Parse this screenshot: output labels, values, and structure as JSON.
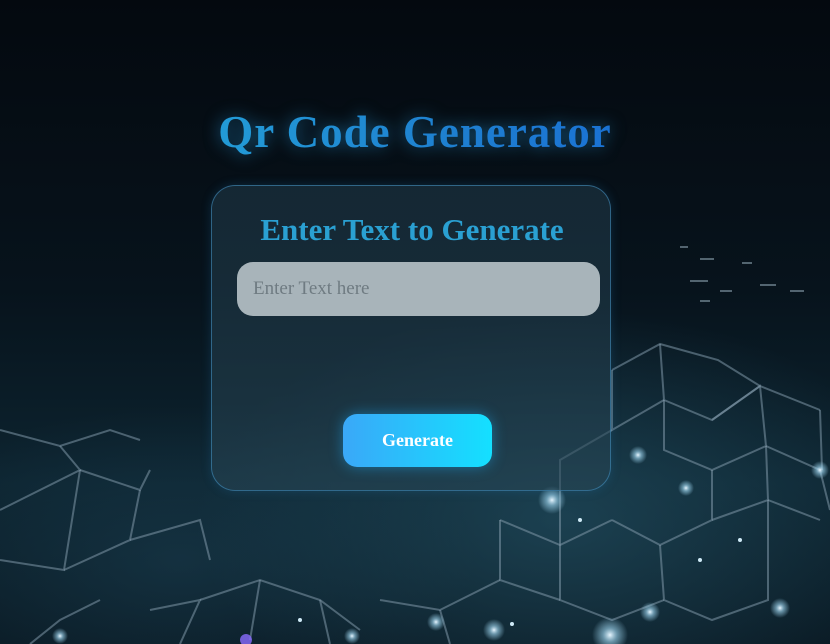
{
  "page": {
    "title": "Qr Code Generator"
  },
  "card": {
    "heading": "Enter Text to Generate",
    "input": {
      "placeholder": "Enter Text here",
      "value": ""
    },
    "generate_label": "Generate"
  },
  "colors": {
    "title_gradient_start": "#27b4dc",
    "title_gradient_end": "#1560d8",
    "heading": "#2aa0d2",
    "button_gradient_start": "#3aa8f8",
    "button_gradient_end": "#14e0ff",
    "background": "#04090f"
  }
}
